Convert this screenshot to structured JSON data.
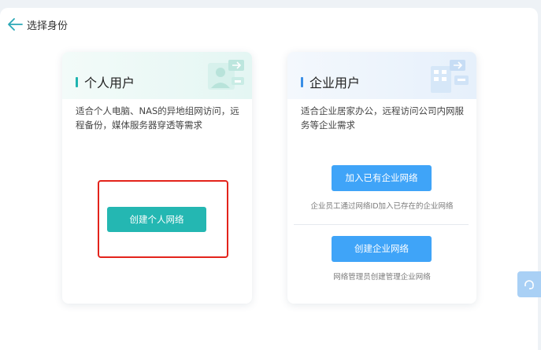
{
  "header": {
    "title": "选择身份"
  },
  "personal": {
    "title": "个人用户",
    "description": "适合个人电脑、NAS的异地组网访问，远程备份，媒体服务器穿透等需求",
    "button": "创建个人网络"
  },
  "enterprise": {
    "title": "企业用户",
    "description": "适合企业居家办公，远程访问公司内网服务等企业需求",
    "join_button": "加入已有企业网络",
    "join_hint": "企业员工通过网络ID加入已存在的企业网络",
    "create_button": "创建企业网络",
    "create_hint": "网络管理员创建管理企业网络"
  },
  "colors": {
    "teal": "#24b7b2",
    "blue": "#3fa4f8",
    "highlight": "#e3231b"
  },
  "icons": {
    "back": "back-arrow-icon",
    "support": "support-headset-icon"
  }
}
